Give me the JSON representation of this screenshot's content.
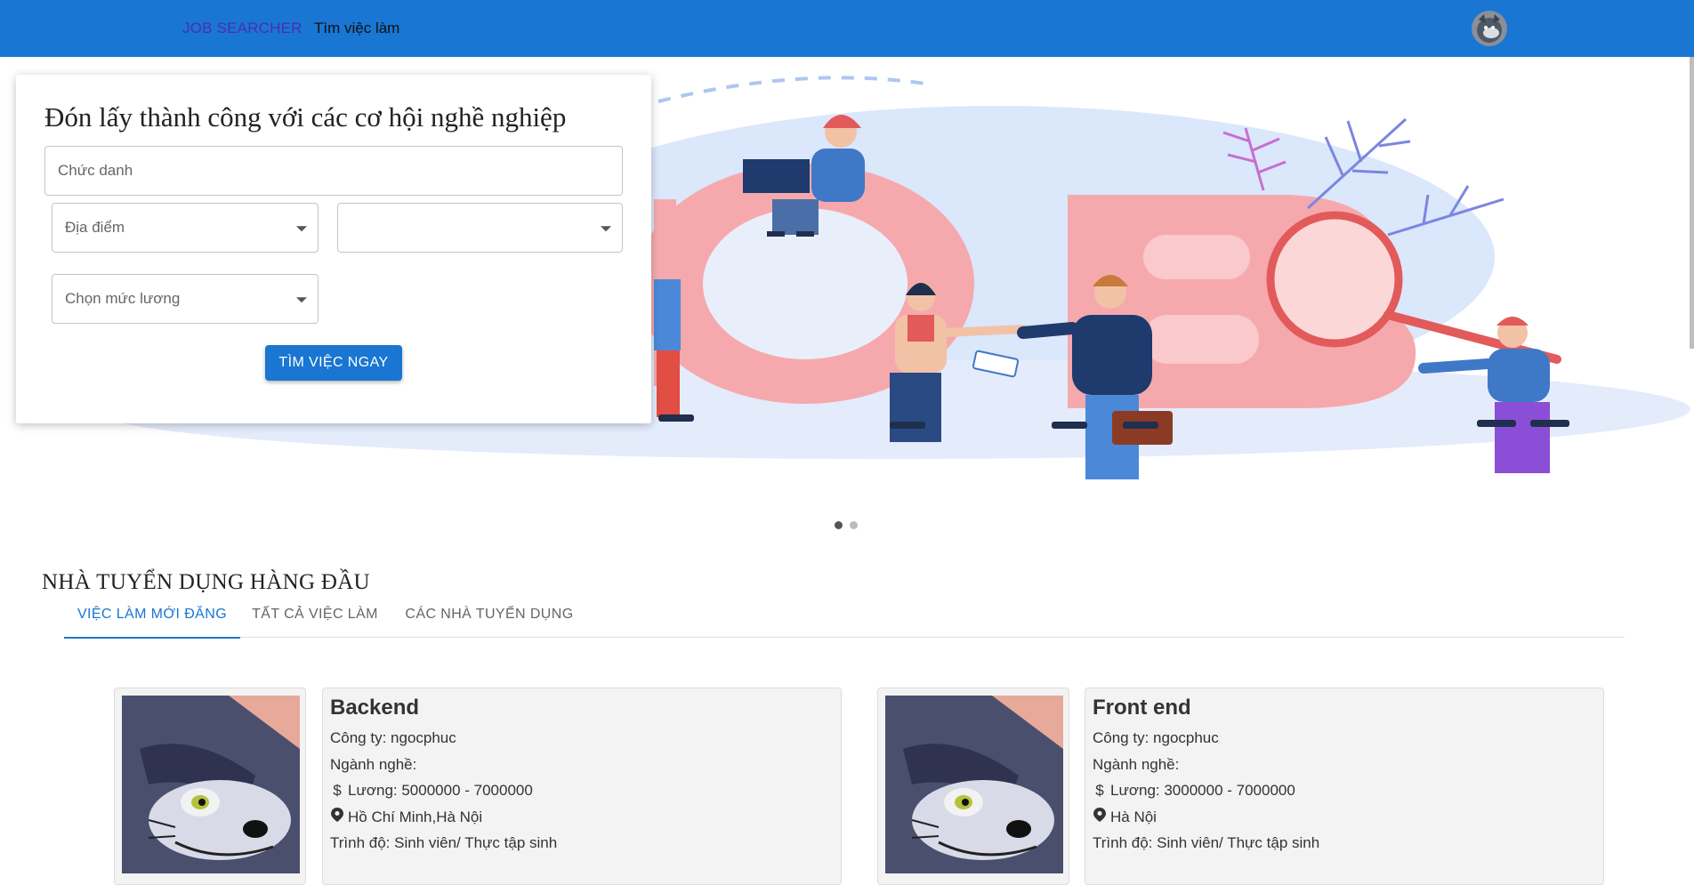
{
  "header": {
    "brand": "JOB SEARCHER",
    "nav_link": "Tìm việc làm"
  },
  "search": {
    "title": "Đón lấy thành công với các cơ hội nghề nghiệp",
    "job_title_placeholder": "Chức danh",
    "location_placeholder": "Địa điểm",
    "second_select_value": "",
    "salary_placeholder": "Chọn mức lương",
    "submit_label": "TÌM VIỆC NGAY"
  },
  "carousel": {
    "slide_count": 2,
    "active_slide": 1
  },
  "employers": {
    "title": "NHÀ TUYỂN DỤNG HÀNG ĐẦU",
    "tabs": [
      {
        "label": "VIỆC LÀM MỚI ĐĂNG",
        "active": true
      },
      {
        "label": "TẤT CẢ VIỆC LÀM",
        "active": false
      },
      {
        "label": "CÁC NHÀ TUYỂN DỤNG",
        "active": false
      }
    ]
  },
  "jobs": [
    {
      "title": "Backend",
      "company": "Công ty: ngocphuc",
      "industry": "Ngành nghề:",
      "salary": "Lương: 5000000 - 7000000",
      "location": "Hồ Chí Minh,Hà Nội",
      "level": "Trình độ: Sinh viên/ Thực tập sinh"
    },
    {
      "title": "Front end",
      "company": "Công ty: ngocphuc",
      "industry": "Ngành nghề:",
      "salary": "Lương: 3000000 - 7000000",
      "location": "Hà Nội",
      "level": "Trình độ: Sinh viên/ Thực tập sinh"
    }
  ],
  "icons": {
    "salary": "dollar-icon",
    "location": "map-pin-icon"
  },
  "colors": {
    "primary": "#1976d2",
    "brand_text": "#4a2fb0",
    "card_bg": "#f3f3f3",
    "hero_pink": "#f6a9ad",
    "hero_blue": "#dbe7fb"
  }
}
